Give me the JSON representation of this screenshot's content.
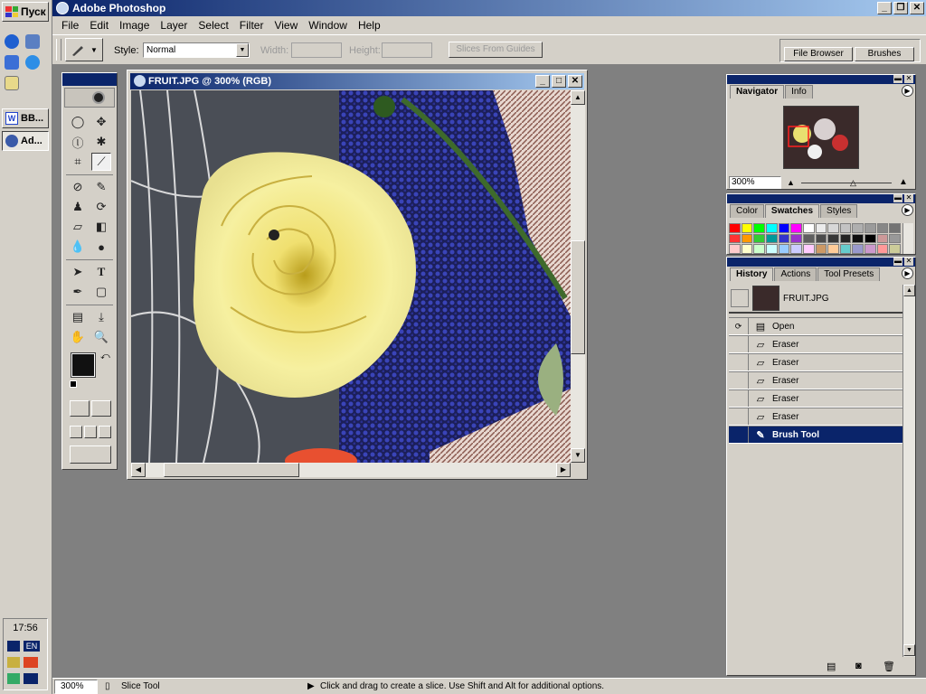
{
  "taskbar": {
    "start_label": "Пуск",
    "tasks": [
      {
        "label": "BB...",
        "icon": "word-icon"
      },
      {
        "label": "Ad...",
        "icon": "photoshop-icon"
      }
    ],
    "clock": "17:56",
    "lang": "EN"
  },
  "app": {
    "title": "Adobe Photoshop",
    "menus": [
      "File",
      "Edit",
      "Image",
      "Layer",
      "Select",
      "Filter",
      "View",
      "Window",
      "Help"
    ]
  },
  "options": {
    "style_label": "Style:",
    "style_value": "Normal",
    "width_label": "Width:",
    "height_label": "Height:",
    "slices_btn": "Slices From Guides",
    "well_tabs": [
      "File Browser",
      "Brushes"
    ]
  },
  "document": {
    "title": "FRUIT.JPG @ 300% (RGB)"
  },
  "navigator": {
    "tabs": [
      "Navigator",
      "Info"
    ],
    "zoom": "300%"
  },
  "swatches": {
    "tabs": [
      "Color",
      "Swatches",
      "Styles"
    ],
    "colors": [
      "#ff0000",
      "#ffff00",
      "#00ff00",
      "#00ffff",
      "#0000ff",
      "#ff00ff",
      "#ffffff",
      "#ebebeb",
      "#d7d7d7",
      "#c3c3c3",
      "#afafaf",
      "#9b9b9b",
      "#878787",
      "#737373",
      "#ff3333",
      "#ff9900",
      "#33cc33",
      "#009999",
      "#3333cc",
      "#9933cc",
      "#5f5f5f",
      "#4b4b4b",
      "#373737",
      "#232323",
      "#0f0f0f",
      "#000000",
      "#cc9999",
      "#999999",
      "#ffcccc",
      "#ffffcc",
      "#ccffcc",
      "#ccffff",
      "#99ccff",
      "#ccccff",
      "#ffccff",
      "#cc9966",
      "#ffcc99",
      "#66cccc",
      "#9999cc",
      "#cc99cc",
      "#ff9999",
      "#cccc99"
    ]
  },
  "history": {
    "tabs": [
      "History",
      "Actions",
      "Tool Presets"
    ],
    "snapshot": "FRUIT.JPG",
    "steps": [
      {
        "label": "Open",
        "selected": false
      },
      {
        "label": "Eraser",
        "selected": false
      },
      {
        "label": "Eraser",
        "selected": false
      },
      {
        "label": "Eraser",
        "selected": false
      },
      {
        "label": "Eraser",
        "selected": false
      },
      {
        "label": "Eraser",
        "selected": false
      },
      {
        "label": "Brush Tool",
        "selected": true
      }
    ]
  },
  "status": {
    "zoom": "300%",
    "tool": "Slice Tool",
    "hint": "Click and drag to create a slice. Use Shift and Alt for additional options."
  },
  "colors": {
    "titlebar": "#0a246a",
    "face": "#d4d0c8",
    "workspace": "#808080"
  }
}
